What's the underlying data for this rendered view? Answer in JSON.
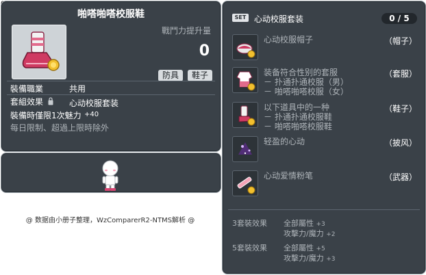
{
  "item_id": "01073176",
  "item": {
    "title": "啪嗒啪嗒校服鞋",
    "stat_label": "戰鬥力提升量",
    "stat_value": "0",
    "tags": [
      "防具",
      "鞋子"
    ],
    "job_label": "裝備職業",
    "job_value": "共用",
    "set_label": "套組效果",
    "set_value": "心动校服套装",
    "charm_text": "裝備時僅限1次魅力",
    "charm_bonus": "+40",
    "limit_text": "每日限制、超過上限時除外"
  },
  "set": {
    "badge": "SET",
    "name": "心动校服套装",
    "count": "0 / 5",
    "items": [
      {
        "name": "心动校服帽子",
        "sub": [],
        "type": "（帽子）",
        "icon": "hat-icon"
      },
      {
        "name": "装备符合性别的套服",
        "sub": [
          "－ 扑通扑通校服（男）",
          "－ 啪嗒啪嗒校服（女）"
        ],
        "type": "（套服）",
        "icon": "outfit-icon"
      },
      {
        "name": "以下道具中的一种",
        "sub": [
          "－ 扑通扑通校服鞋",
          "－ 啪嗒啪嗒校服鞋"
        ],
        "type": "（鞋子）",
        "icon": "shoe-icon"
      },
      {
        "name": "轻盈的心动",
        "sub": [],
        "type": "（披风）",
        "icon": "cape-icon"
      },
      {
        "name": "心动爱情粉笔",
        "sub": [],
        "type": "（武器）",
        "icon": "chalk-icon"
      }
    ],
    "effects": [
      {
        "label": "3套裝效果",
        "lines": [
          {
            "text": "全部屬性",
            "value": "+3"
          },
          {
            "text": "攻擊力/魔力",
            "value": "+2"
          }
        ]
      },
      {
        "label": "5套裝效果",
        "lines": [
          {
            "text": "全部屬性",
            "value": "+5"
          },
          {
            "text": "攻擊力/魔力",
            "value": "+3"
          }
        ]
      }
    ]
  },
  "footer": "@ 数据由小册子整理，WzComparerR2-NTMS解析 @"
}
